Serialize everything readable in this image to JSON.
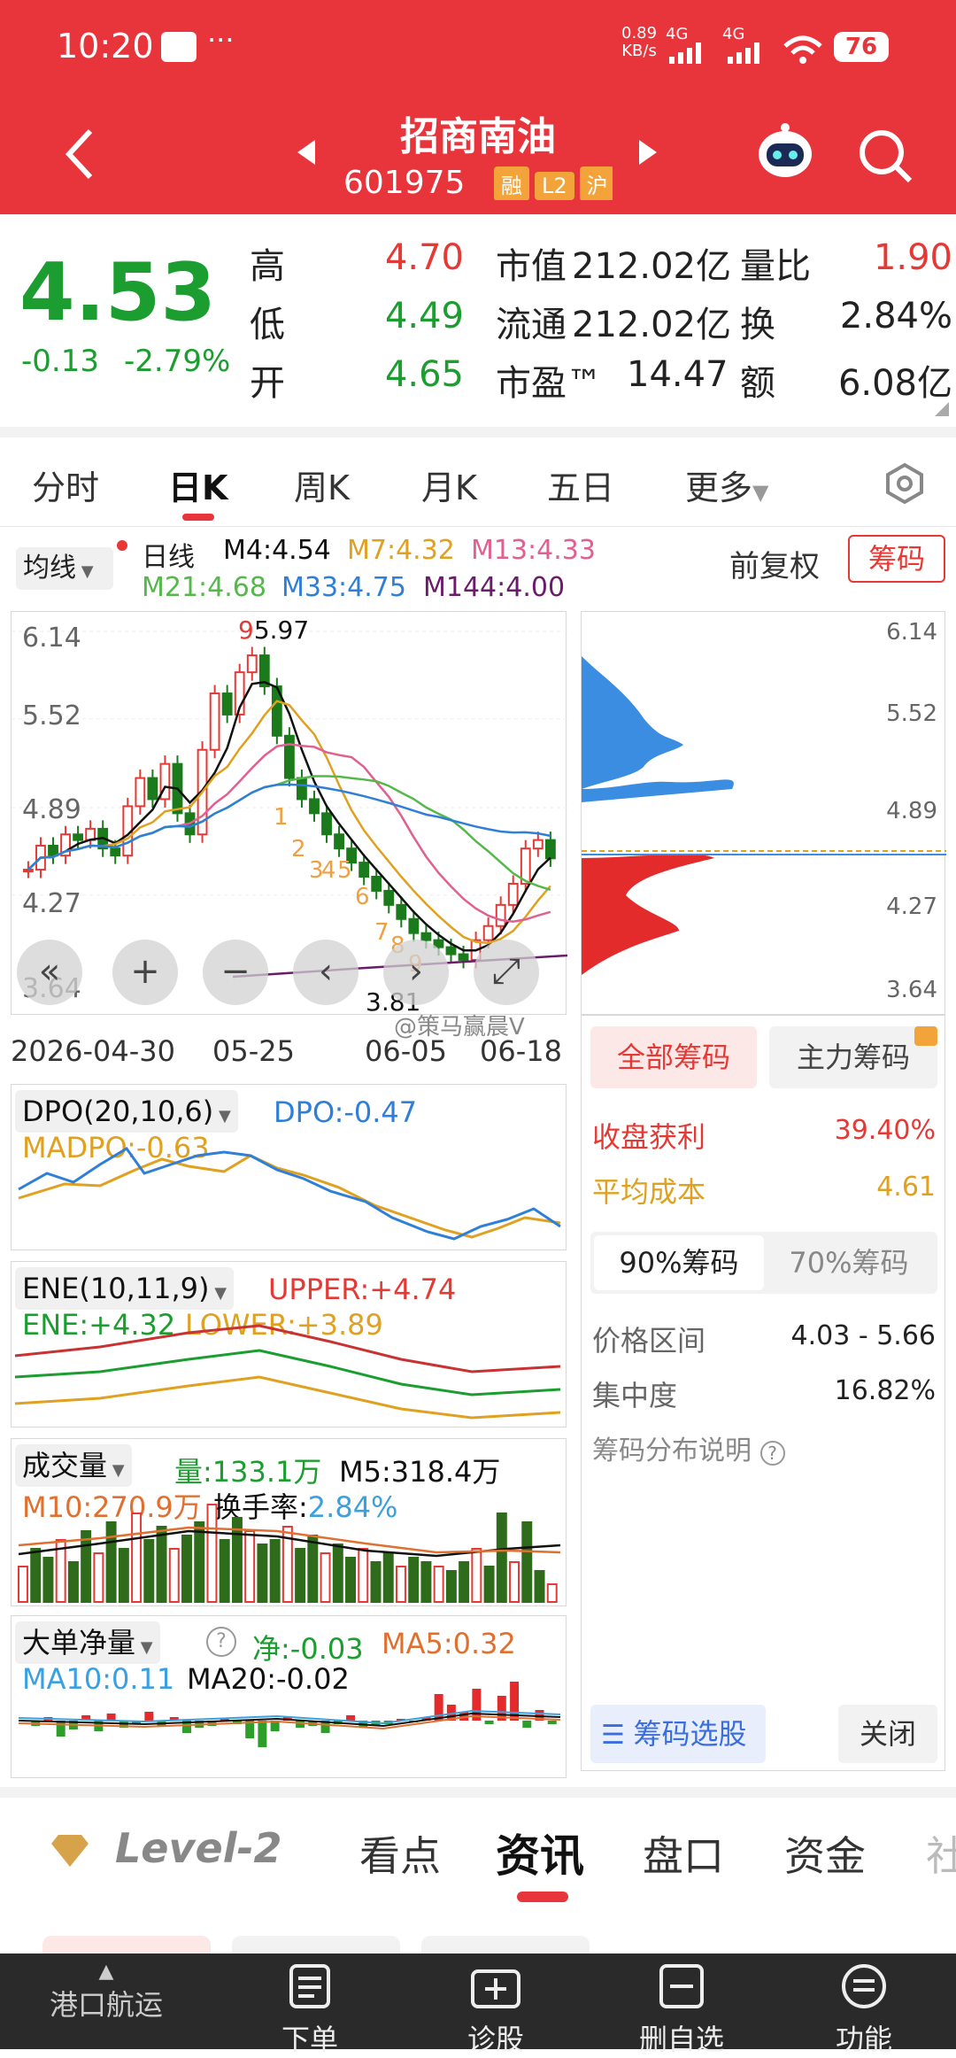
{
  "status": {
    "time": "10:20",
    "net_speed": "0.89",
    "net_unit": "KB/s",
    "net_type1": "4G",
    "net_type2": "4G",
    "battery": "76",
    "dots": "···"
  },
  "nav": {
    "title": "招商南油",
    "code": "601975",
    "tags": [
      "融",
      "L2",
      "沪"
    ]
  },
  "quote": {
    "price": "4.53",
    "change": "-0.13",
    "change_pct": "-2.79%",
    "rows": [
      {
        "l1": "高",
        "v1": "4.70",
        "l2": "市值",
        "v2": "212.02亿",
        "l3": "量比",
        "v3": "1.90"
      },
      {
        "l1": "低",
        "v1": "4.49",
        "l2": "流通",
        "v2": "212.02亿",
        "l3": "换",
        "v3": "2.84%"
      },
      {
        "l1": "开",
        "v1": "4.65",
        "l2": "市盈™",
        "v2": "14.47",
        "l3": "额",
        "v3": "6.08亿"
      }
    ]
  },
  "tabs": [
    "分时",
    "日K",
    "周K",
    "月K",
    "五日",
    "更多"
  ],
  "kline": {
    "ma_btn": "均线",
    "day_label": "日线",
    "m4": "M4:4.54",
    "m7": "M7:4.32",
    "m13": "M13:4.33",
    "m21": "M21:4.68",
    "m33": "M33:4.75",
    "m144": "M144:4.00",
    "fq": "前复权",
    "chip_btn": "筹码",
    "yticks": [
      "6.14",
      "5.52",
      "4.89",
      "4.27",
      "3.64"
    ],
    "xticks": [
      "2026-04-30",
      "05-25",
      "06-05",
      "06-18"
    ],
    "high_label": "5.97",
    "low_label": "3.81",
    "nine_label": "9",
    "watermark": "@策马赢晨V",
    "seq_labels": [
      "1",
      "2",
      "3",
      "4",
      "5",
      "6",
      "7",
      "8",
      "9"
    ]
  },
  "chips": {
    "all": "全部筹码",
    "main": "主力筹码",
    "profit_label": "收盘获利",
    "profit": "39.40%",
    "avg_label": "平均成本",
    "avg": "4.61",
    "pct90": "90%筹码",
    "pct70": "70%筹码",
    "range_label": "价格区间",
    "range": "4.03 - 5.66",
    "conc_label": "集中度",
    "conc": "16.82%",
    "explain": "筹码分布说明",
    "select": "筹码选股",
    "close": "关闭"
  },
  "dpo": {
    "name": "DPO(20,10,6)",
    "dpo": "DPO:-0.47",
    "madpo": "MADPO:-0.63"
  },
  "ene": {
    "name": "ENE(10,11,9)",
    "upper": "UPPER:+4.74",
    "ene": "ENE:+4.32",
    "lower": "LOWER:+3.89"
  },
  "vol": {
    "name": "成交量",
    "vol": "量:133.1万",
    "m5": "M5:318.4万",
    "m10": "M10:270.9万",
    "turnover_label": "换手率:",
    "turnover": "2.84%"
  },
  "big": {
    "name": "大单净量",
    "net": "净:-0.03",
    "ma5": "MA5:0.32",
    "ma10": "MA10:0.11",
    "ma20": "MA20:-0.02"
  },
  "bottom_tabs": [
    "Level-2",
    "看点",
    "资讯",
    "盘口",
    "资金",
    "社"
  ],
  "bottom_bar": [
    "港口航运",
    "下单",
    "诊股",
    "删自选",
    "功能"
  ],
  "colors": {
    "brand_red": "#e8343b",
    "up_red": "#e53935",
    "down_green": "#1b7a1b",
    "chip_blue": "#3a8de0"
  },
  "chart_data": {
    "type": "candlestick",
    "x": [
      "2026-04-30",
      "05-25",
      "06-05",
      "06-18"
    ],
    "ylim": [
      3.64,
      6.14
    ],
    "high": 5.97,
    "low": 3.81,
    "last_close": 4.53
  }
}
